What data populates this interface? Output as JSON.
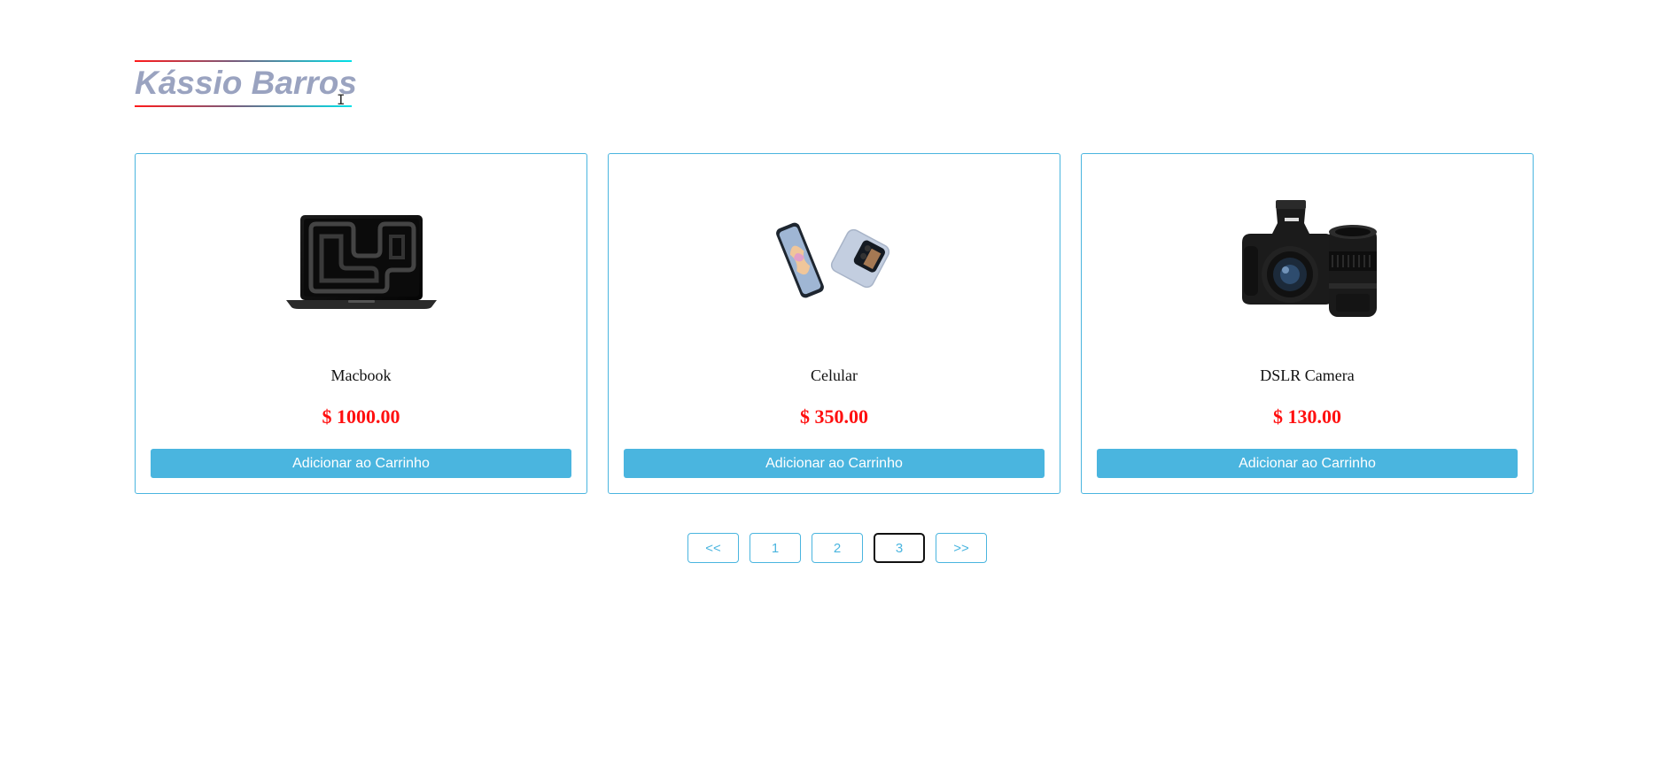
{
  "brand": {
    "title": "Kássio Barros"
  },
  "products": [
    {
      "name": "Macbook",
      "price": "$ 1000.00",
      "button_label": "Adicionar ao Carrinho",
      "image_icon": "laptop-image"
    },
    {
      "name": "Celular",
      "price": "$ 350.00",
      "button_label": "Adicionar ao Carrinho",
      "image_icon": "foldable-phone-image"
    },
    {
      "name": "DSLR Camera",
      "price": "$ 130.00",
      "button_label": "Adicionar ao Carrinho",
      "image_icon": "camera-image"
    }
  ],
  "pagination": {
    "prev_label": "<<",
    "pages": [
      "1",
      "2",
      "3"
    ],
    "current_page": "3",
    "next_label": ">>"
  },
  "colors": {
    "accent": "#4ab5df",
    "price": "#ff1010",
    "brand_text": "#9aa3c0",
    "gradient_start": "#ff1a1a",
    "gradient_end": "#00e1e8"
  }
}
